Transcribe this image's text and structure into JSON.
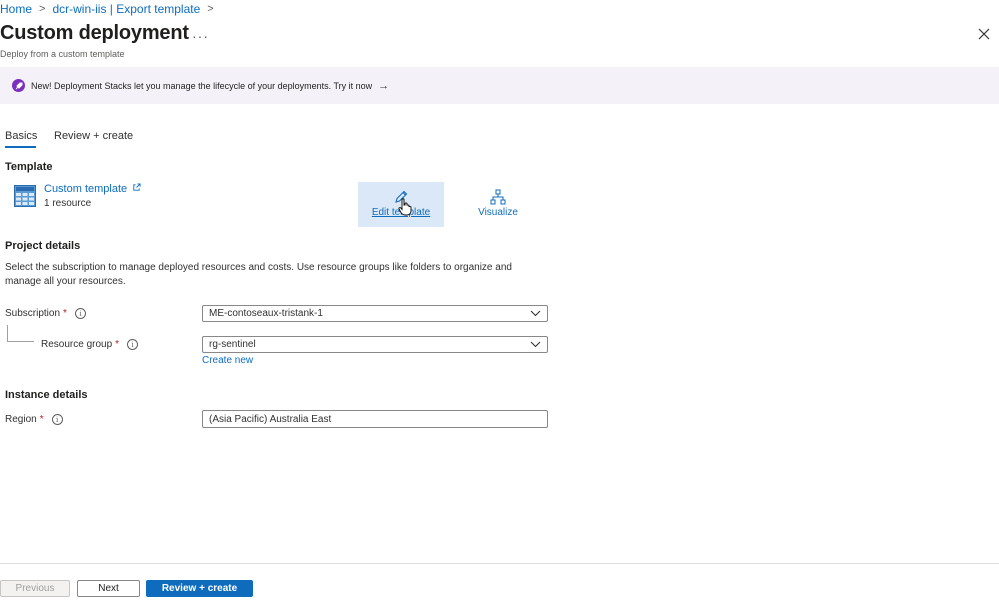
{
  "breadcrumb": {
    "items": [
      "Home",
      "dcr-win-iis | Export template"
    ]
  },
  "header": {
    "title": "Custom deployment",
    "more_label": "···",
    "subtitle": "Deploy from a custom template"
  },
  "banner": {
    "text": "New! Deployment Stacks let you manage the lifecycle of your deployments. Try it now",
    "arrow": "→"
  },
  "tabs": [
    {
      "label": "Basics",
      "active": true
    },
    {
      "label": "Review + create",
      "active": false
    }
  ],
  "template": {
    "section_title": "Template",
    "name": "Custom template",
    "count": "1 resource",
    "edit_label": "Edit template",
    "visualize_label": "Visualize"
  },
  "project": {
    "section_title": "Project details",
    "description": "Select the subscription to manage deployed resources and costs. Use resource groups like folders to organize and manage all your resources.",
    "subscription_label": "Subscription",
    "subscription_value": "ME-contoseaux-tristank-1",
    "resource_group_label": "Resource group",
    "resource_group_value": "rg-sentinel",
    "create_new": "Create new"
  },
  "instance": {
    "section_title": "Instance details",
    "region_label": "Region",
    "region_value": "(Asia Pacific) Australia East"
  },
  "footer": {
    "previous": "Previous",
    "next": "Next",
    "review": "Review + create"
  },
  "colors": {
    "accent": "#0f6cbd",
    "banner_bg": "#f4f2f8",
    "required": "#a4262c"
  }
}
